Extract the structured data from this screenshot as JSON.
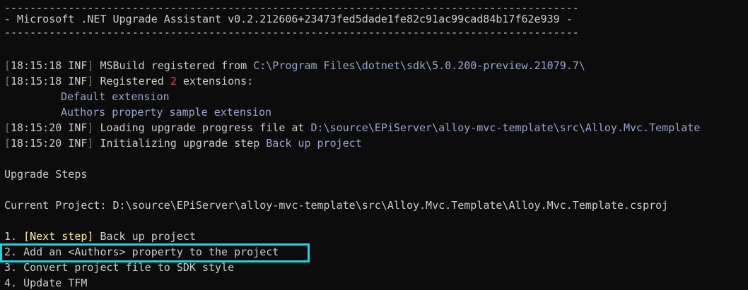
{
  "banner": {
    "rule_top": "------------------------------------------------------------------------------------------",
    "title": "- Microsoft .NET Upgrade Assistant v0.2.212606+23473fed5dade1fe82c91ac99cad84b17f62e939 -",
    "rule_bottom": "------------------------------------------------------------------------------------------"
  },
  "log": [
    {
      "open": "[",
      "time_level": "18:15:18 INF",
      "close": "]",
      "message": " MSBuild registered from ",
      "value": "C:\\Program Files\\dotnet\\sdk\\5.0.200-preview.21079.7\\"
    },
    {
      "open": "[",
      "time_level": "18:15:18 INF",
      "close": "]",
      "message": " Registered ",
      "count": "2",
      "suffix": " extensions:"
    },
    {
      "extension": "Default extension"
    },
    {
      "extension": "Authors property sample extension"
    },
    {
      "open": "[",
      "time_level": "18:15:20 INF",
      "close": "]",
      "message": " Loading upgrade progress file at ",
      "value": "D:\\source\\EPiServer\\alloy-mvc-template\\src\\Alloy.Mvc.Template"
    },
    {
      "open": "[",
      "time_level": "18:15:20 INF",
      "close": "]",
      "message": " Initializing upgrade step ",
      "value": "Back up project"
    }
  ],
  "upgrade_steps": {
    "heading": "Upgrade Steps",
    "current_project_label": "Current Project: ",
    "current_project_path": "D:\\source\\EPiServer\\alloy-mvc-template\\src\\Alloy.Mvc.Template\\Alloy.Mvc.Template.csproj",
    "steps": [
      {
        "number": "1. ",
        "tag": "[Next step]",
        "label": " Back up project"
      },
      {
        "number": "2. ",
        "label": "Add an <Authors> property to the project"
      },
      {
        "number": "3. ",
        "label": "Convert project file to SDK style"
      },
      {
        "number": "4. ",
        "label": "Update TFM"
      }
    ]
  },
  "colors": {
    "background": "#0c0c0c",
    "text": "#cccccc",
    "dim_bracket": "#767676",
    "path": "#9aa5ce",
    "count_red": "#e74856",
    "next_step_yellow": "#f9f1a5",
    "highlight_box": "#22d3e6"
  }
}
